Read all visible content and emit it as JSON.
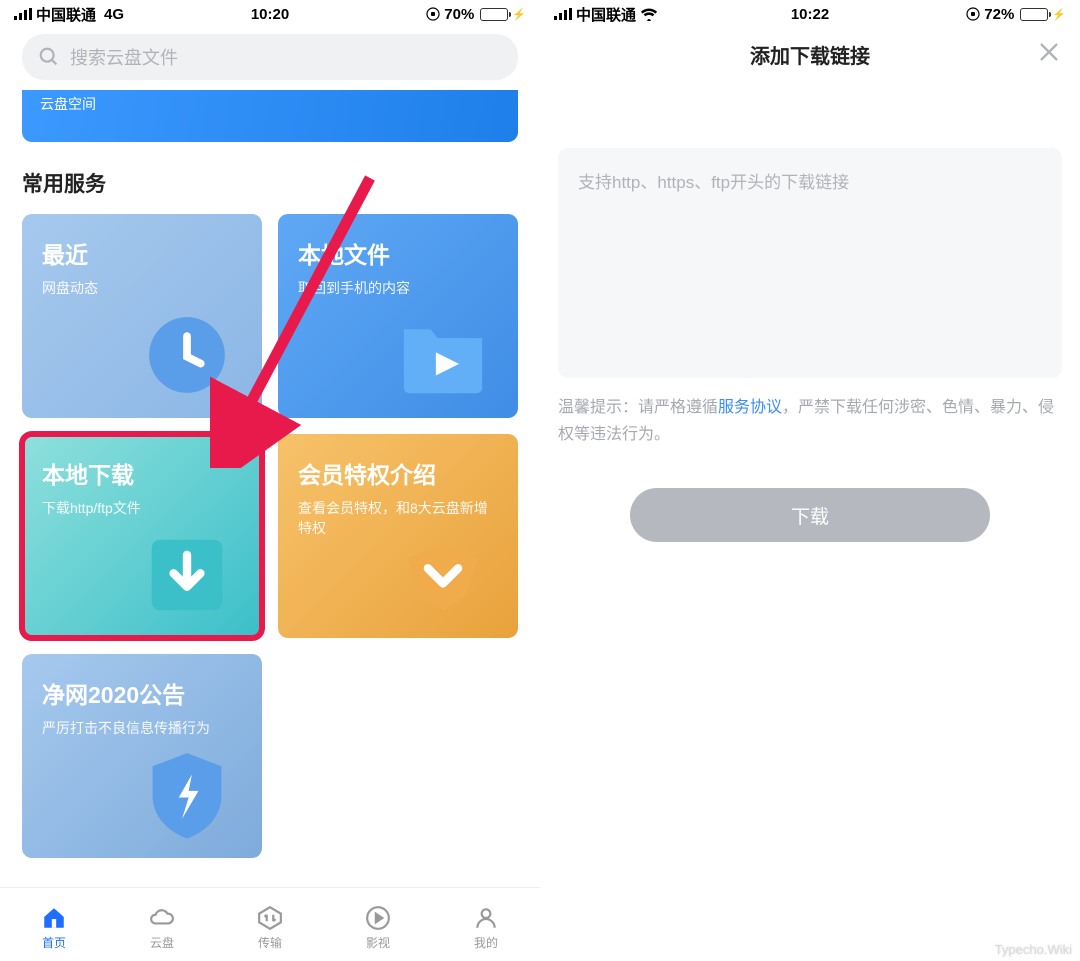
{
  "left": {
    "status": {
      "carrier": "中国联通",
      "network": "4G",
      "time": "10:20",
      "battery": "70%"
    },
    "search_placeholder": "搜索云盘文件",
    "banner_text": "云盘空间",
    "section_title": "常用服务",
    "cards": {
      "recent": {
        "title": "最近",
        "sub": "网盘动态"
      },
      "local": {
        "title": "本地文件",
        "sub": "取回到手机的内容"
      },
      "download": {
        "title": "本地下载",
        "sub": "下载http/ftp文件"
      },
      "vip": {
        "title": "会员特权介绍",
        "sub": "查看会员特权，和8大云盘新增特权"
      },
      "notice": {
        "title": "净网2020公告",
        "sub": "严厉打击不良信息传播行为"
      }
    },
    "nav": {
      "home": "首页",
      "cloud": "云盘",
      "transfer": "传输",
      "video": "影视",
      "me": "我的"
    }
  },
  "right": {
    "status": {
      "carrier": "中国联通",
      "time": "10:22",
      "battery": "72%"
    },
    "header_title": "添加下载链接",
    "textarea_placeholder": "支持http、https、ftp开头的下载链接",
    "tip_prefix": "温馨提示：请严格遵循",
    "tip_link": "服务协议",
    "tip_suffix": "，严禁下载任何涉密、色情、暴力、侵权等违法行为。",
    "download_btn": "下载"
  },
  "watermark": "Typecho.Wiki"
}
